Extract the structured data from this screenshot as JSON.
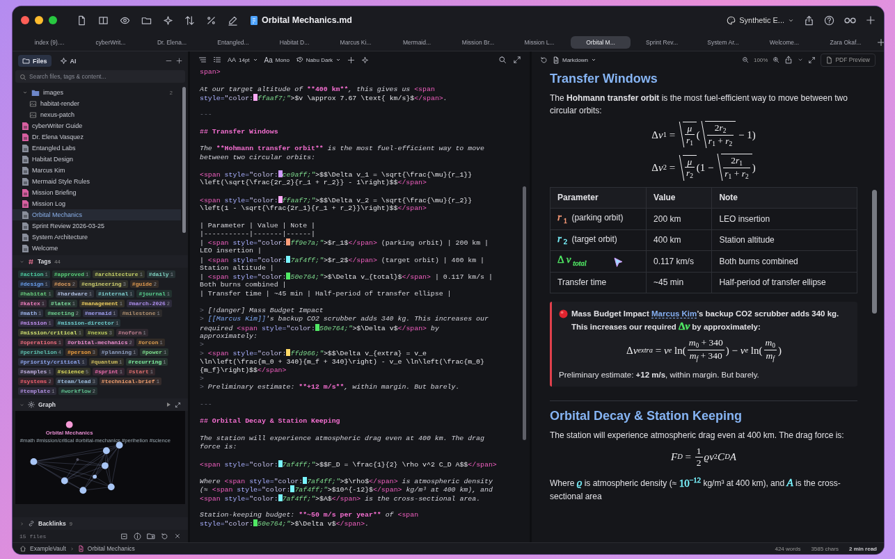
{
  "window": {
    "title": "Orbital Mechanics.md",
    "workspace": "Synthetic E..."
  },
  "tabs": [
    {
      "label": "index (9)....",
      "selected": false
    },
    {
      "label": "cyberWrit...",
      "selected": false
    },
    {
      "label": "Dr. Elena...",
      "selected": false
    },
    {
      "label": "Entangled...",
      "selected": false
    },
    {
      "label": "Habitat D...",
      "selected": false
    },
    {
      "label": "Marcus Ki...",
      "selected": false
    },
    {
      "label": "Mermaid...",
      "selected": false
    },
    {
      "label": "Mission Br...",
      "selected": false
    },
    {
      "label": "Mission L...",
      "selected": false
    },
    {
      "label": "Orbital M...",
      "selected": true
    },
    {
      "label": "Sprint Rev...",
      "selected": false
    },
    {
      "label": "System Ar...",
      "selected": false
    },
    {
      "label": "Welcome...",
      "selected": false
    },
    {
      "label": "Zara Okaf...",
      "selected": false
    }
  ],
  "sidebar": {
    "tabs": [
      {
        "label": "Files",
        "selected": true
      },
      {
        "label": "AI",
        "selected": false
      }
    ],
    "search": {
      "placeholder": "Search files, tags & content..."
    },
    "tree": [
      {
        "kind": "folder",
        "name": "images",
        "count": "2",
        "expanded": true,
        "selected": false,
        "children": [
          {
            "kind": "image",
            "name": "habitat-render",
            "selected": false
          },
          {
            "kind": "image",
            "name": "nexus-patch",
            "selected": false
          }
        ]
      },
      {
        "kind": "file",
        "name": "cyberWriter Guide",
        "color": "#d75fa0",
        "selected": false
      },
      {
        "kind": "file",
        "name": "Dr. Elena Vasquez",
        "color": "#d75fa0",
        "selected": false
      },
      {
        "kind": "file",
        "name": "Entangled Labs",
        "color": "#8a8f9c",
        "selected": false
      },
      {
        "kind": "file",
        "name": "Habitat Design",
        "color": "#8a8f9c",
        "selected": false
      },
      {
        "kind": "file",
        "name": "Marcus Kim",
        "color": "#8a8f9c",
        "selected": false
      },
      {
        "kind": "file",
        "name": "Mermaid Style Rules",
        "color": "#8a8f9c",
        "selected": false
      },
      {
        "kind": "file",
        "name": "Mission Briefing",
        "color": "#d75fa0",
        "selected": false
      },
      {
        "kind": "file",
        "name": "Mission Log",
        "color": "#d75fa0",
        "selected": false
      },
      {
        "kind": "file",
        "name": "Orbital Mechanics",
        "color": "#8a8f9c",
        "selected": true
      },
      {
        "kind": "file",
        "name": "Sprint Review 2026-03-25",
        "color": "#8a8f9c",
        "selected": false
      },
      {
        "kind": "file",
        "name": "System Architecture",
        "color": "#8a8f9c",
        "selected": false
      },
      {
        "kind": "file",
        "name": "Welcome",
        "color": "#8a8f9c",
        "selected": false
      }
    ],
    "tags": {
      "title": "Tags",
      "count": "44",
      "expanded": true,
      "items": [
        {
          "name": "#action",
          "count": "1",
          "color": "#4fd1a5"
        },
        {
          "name": "#approved",
          "count": "1",
          "color": "#5ad17a"
        },
        {
          "name": "#architecture",
          "count": "1",
          "color": "#c8d46a"
        },
        {
          "name": "#daily",
          "count": "1",
          "color": "#7fd1c0"
        },
        {
          "name": "#design",
          "count": "1",
          "color": "#6aa0f0"
        },
        {
          "name": "#docs",
          "count": "2",
          "color": "#e0a060"
        },
        {
          "name": "#engineering",
          "count": "3",
          "color": "#d0d070"
        },
        {
          "name": "#guide",
          "count": "2",
          "color": "#e09a50"
        },
        {
          "name": "#habitat",
          "count": "1",
          "color": "#6ad080"
        },
        {
          "name": "#hardware",
          "count": "1",
          "color": "#b0c0e0"
        },
        {
          "name": "#internal",
          "count": "1",
          "color": "#7fd0d0"
        },
        {
          "name": "#journal",
          "count": "1",
          "color": "#5ad090"
        },
        {
          "name": "#katex",
          "count": "1",
          "color": "#f080c0"
        },
        {
          "name": "#latex",
          "count": "1",
          "color": "#80e0a0"
        },
        {
          "name": "#management",
          "count": "1",
          "color": "#f0d060"
        },
        {
          "name": "#march-2026",
          "count": "2",
          "color": "#b090f0"
        },
        {
          "name": "#math",
          "count": "1",
          "color": "#a0b8f0"
        },
        {
          "name": "#meeting",
          "count": "2",
          "color": "#70d090"
        },
        {
          "name": "#mermaid",
          "count": "1",
          "color": "#a0a0f0"
        },
        {
          "name": "#milestone",
          "count": "1",
          "color": "#b09070"
        },
        {
          "name": "#mission",
          "count": "1",
          "color": "#c090f0"
        },
        {
          "name": "#mission-director",
          "count": "1",
          "color": "#70d0d0"
        },
        {
          "name": "#mission/critical",
          "count": "1",
          "color": "#d0e070"
        },
        {
          "name": "#nexus",
          "count": "3",
          "color": "#c0d060"
        },
        {
          "name": "#noforn",
          "count": "1",
          "color": "#c08090"
        },
        {
          "name": "#operations",
          "count": "1",
          "color": "#f07080"
        },
        {
          "name": "#orbital-mechanics",
          "count": "2",
          "color": "#f090d0"
        },
        {
          "name": "#orcon",
          "count": "1",
          "color": "#e0a050"
        },
        {
          "name": "#perihelion",
          "count": "4",
          "color": "#60c0b0"
        },
        {
          "name": "#person",
          "count": "3",
          "color": "#f0a040"
        },
        {
          "name": "#planning",
          "count": "1",
          "color": "#90a0c0"
        },
        {
          "name": "#power",
          "count": "1",
          "color": "#80e090"
        },
        {
          "name": "#priority/critical",
          "count": "1",
          "color": "#90a8f0"
        },
        {
          "name": "#quantum",
          "count": "1",
          "color": "#d0c060"
        },
        {
          "name": "#recurring",
          "count": "1",
          "color": "#80f0a0"
        },
        {
          "name": "#samples",
          "count": "1",
          "color": "#c0b0e0"
        },
        {
          "name": "#science",
          "count": "5",
          "color": "#e0e060"
        },
        {
          "name": "#sprint",
          "count": "1",
          "color": "#f070b0"
        },
        {
          "name": "#start",
          "count": "1",
          "color": "#e07070"
        },
        {
          "name": "#systems",
          "count": "2",
          "color": "#f06070"
        },
        {
          "name": "#team/lead",
          "count": "3",
          "color": "#a0c0e0"
        },
        {
          "name": "#technical-brief",
          "count": "1",
          "color": "#f0a070"
        },
        {
          "name": "#template",
          "count": "1",
          "color": "#b090e0"
        },
        {
          "name": "#workflow",
          "count": "2",
          "color": "#60c090"
        }
      ]
    },
    "graph": {
      "title": "Graph",
      "expanded": true,
      "focus": "Orbital Mechanics",
      "labels": "#math #mission/critical #orbital-mechanics #perihelion #science"
    },
    "backlinks": {
      "title": "Backlinks",
      "count": "9",
      "expanded": false
    },
    "footer": {
      "files": "15 files"
    }
  },
  "editor": {
    "toolbar": {
      "size_glyph": "AA",
      "font_size": "14pt",
      "font_glyph": "Aa",
      "font": "Mono",
      "theme": "Nabu Dark"
    },
    "blocks": [
      {
        "lines": [
          [
            {
              "kind": "tag",
              "text": "span>"
            }
          ]
        ]
      },
      {
        "lines": [
          [
            {
              "kind": "p",
              "text": "At our target altitude of "
            },
            {
              "kind": "b",
              "text": "**400 km**"
            },
            {
              "kind": "p",
              "text": ", this gives us "
            },
            {
              "kind": "tag",
              "text": "<span"
            }
          ],
          [
            {
              "kind": "at",
              "text": "style="
            },
            {
              "kind": "s",
              "text": "\"color:"
            },
            {
              "kind": "sw",
              "color": "#ffaaf7"
            },
            {
              "kind": "hx",
              "text": "ffaaf7;\""
            },
            {
              "kind": "m",
              "text": ">$v \\approx 7.67 \\text{ km/s}$"
            },
            {
              "kind": "tag",
              "text": "</span>"
            },
            {
              "kind": "p",
              "text": "."
            }
          ]
        ]
      },
      {
        "lines": [
          [
            {
              "kind": "q",
              "text": "---"
            }
          ]
        ]
      },
      {
        "lines": [
          [
            {
              "kind": "h",
              "text": "## Transfer Windows"
            }
          ]
        ]
      },
      {
        "lines": [
          [
            {
              "kind": "p",
              "text": "The "
            },
            {
              "kind": "b",
              "text": "**Hohmann transfer orbit**"
            },
            {
              "kind": "p",
              "text": " is the most fuel-efficient way to move"
            }
          ],
          [
            {
              "kind": "p",
              "text": "between two circular orbits:"
            }
          ]
        ]
      },
      {
        "lines": [
          [
            {
              "kind": "tag",
              "text": "<span"
            },
            {
              "kind": "at",
              "text": " style="
            },
            {
              "kind": "s",
              "text": "\"color:"
            },
            {
              "kind": "sw",
              "color": "#ce9aff"
            },
            {
              "kind": "hx",
              "text": "ce9aff;\""
            },
            {
              "kind": "m",
              "text": ">$$\\Delta v_1 = \\sqrt{\\frac{\\mu}{r_1}}"
            }
          ],
          [
            {
              "kind": "m",
              "text": "\\left(\\sqrt{\\frac{2r_2}{r_1 + r_2}} - 1\\right)$$"
            },
            {
              "kind": "tag",
              "text": "</span>"
            }
          ]
        ]
      },
      {
        "lines": [
          [
            {
              "kind": "tag",
              "text": "<span"
            },
            {
              "kind": "at",
              "text": " style="
            },
            {
              "kind": "s",
              "text": "\"color:"
            },
            {
              "kind": "sw",
              "color": "#ffaaf7"
            },
            {
              "kind": "hx",
              "text": "ffaaf7;\""
            },
            {
              "kind": "m",
              "text": ">$$\\Delta v_2 = \\sqrt{\\frac{\\mu}{r_2}}"
            }
          ],
          [
            {
              "kind": "m",
              "text": "\\left(1 - \\sqrt{\\frac{2r_1}{r_1 + r_2}}\\right)$$"
            },
            {
              "kind": "tag",
              "text": "</span>"
            }
          ]
        ]
      },
      {
        "lines": [
          [
            {
              "kind": "c",
              "text": "| Parameter | Value | Note |"
            }
          ],
          [
            {
              "kind": "c",
              "text": "|-----------|-------|------|"
            }
          ],
          [
            {
              "kind": "c",
              "text": "| "
            },
            {
              "kind": "tag",
              "text": "<span"
            },
            {
              "kind": "at",
              "text": " style="
            },
            {
              "kind": "s",
              "text": "\"color:"
            },
            {
              "kind": "sw",
              "color": "#ff9e7a"
            },
            {
              "kind": "hx",
              "text": "ff9e7a;\""
            },
            {
              "kind": "m",
              "text": ">$r_1$"
            },
            {
              "kind": "tag",
              "text": "</span>"
            },
            {
              "kind": "c",
              "text": " (parking orbit) | 200 km |"
            }
          ],
          [
            {
              "kind": "c",
              "text": "LEO insertion |"
            }
          ],
          [
            {
              "kind": "c",
              "text": "| "
            },
            {
              "kind": "tag",
              "text": "<span"
            },
            {
              "kind": "at",
              "text": " style="
            },
            {
              "kind": "s",
              "text": "\"color:"
            },
            {
              "kind": "sw",
              "color": "#7af4ff"
            },
            {
              "kind": "hx",
              "text": "7af4ff;\""
            },
            {
              "kind": "m",
              "text": ">$r_2$"
            },
            {
              "kind": "tag",
              "text": "</span>"
            },
            {
              "kind": "c",
              "text": " (target orbit) | 400 km |"
            }
          ],
          [
            {
              "kind": "c",
              "text": "Station altitude |"
            }
          ],
          [
            {
              "kind": "c",
              "text": "| "
            },
            {
              "kind": "tag",
              "text": "<span"
            },
            {
              "kind": "at",
              "text": " style="
            },
            {
              "kind": "s",
              "text": "\"color:"
            },
            {
              "kind": "sw",
              "color": "#50e764"
            },
            {
              "kind": "hx",
              "text": "50e764;\""
            },
            {
              "kind": "m",
              "text": ">$\\Delta v_{total}$"
            },
            {
              "kind": "tag",
              "text": "</span>"
            },
            {
              "kind": "c",
              "text": " | 0.117 km/s |"
            }
          ],
          [
            {
              "kind": "c",
              "text": "Both burns combined |"
            }
          ],
          [
            {
              "kind": "c",
              "text": "| Transfer time | ~45 min | Half-period of transfer ellipse |"
            }
          ]
        ]
      },
      {
        "lines": [
          [
            {
              "kind": "q",
              "text": "> "
            },
            {
              "kind": "p",
              "text": "[!danger] Mass Budget Impact"
            }
          ],
          [
            {
              "kind": "q",
              "text": "> "
            },
            {
              "kind": "l",
              "text": "[[Marcus Kim]]"
            },
            {
              "kind": "p",
              "text": "'s backup CO2 scrubber adds 340 kg. This increases our"
            }
          ],
          [
            {
              "kind": "p",
              "text": "required "
            },
            {
              "kind": "tag",
              "text": "<span"
            },
            {
              "kind": "at",
              "text": " style="
            },
            {
              "kind": "s",
              "text": "\"color:"
            },
            {
              "kind": "sw",
              "color": "#50e764"
            },
            {
              "kind": "hx",
              "text": "50e764;\""
            },
            {
              "kind": "m",
              "text": ">$\\Delta v$"
            },
            {
              "kind": "tag",
              "text": "</span>"
            },
            {
              "kind": "p",
              "text": " by"
            }
          ],
          [
            {
              "kind": "p",
              "text": "approximately:"
            }
          ],
          [
            {
              "kind": "q",
              "text": ">"
            }
          ],
          [
            {
              "kind": "q",
              "text": "> "
            },
            {
              "kind": "tag",
              "text": "<span"
            },
            {
              "kind": "at",
              "text": " style="
            },
            {
              "kind": "s",
              "text": "\"color:"
            },
            {
              "kind": "sw",
              "color": "#ffd966"
            },
            {
              "kind": "hx",
              "text": "ffd966;\""
            },
            {
              "kind": "m",
              "text": ">$$\\Delta v_{extra} = v_e"
            }
          ],
          [
            {
              "kind": "m",
              "text": "\\ln\\left(\\frac{m_0 + 340}{m_f + 340}\\right) - v_e \\ln\\left(\\frac{m_0}"
            }
          ],
          [
            {
              "kind": "m",
              "text": "{m_f}\\right)$$"
            },
            {
              "kind": "tag",
              "text": "</span>"
            }
          ],
          [
            {
              "kind": "q",
              "text": ">"
            }
          ],
          [
            {
              "kind": "q",
              "text": "> "
            },
            {
              "kind": "p",
              "text": "Preliminary estimate: "
            },
            {
              "kind": "b",
              "text": "**+12 m/s**"
            },
            {
              "kind": "p",
              "text": ", within margin. But barely."
            }
          ]
        ]
      },
      {
        "lines": [
          [
            {
              "kind": "q",
              "text": "---"
            }
          ]
        ]
      },
      {
        "lines": [
          [
            {
              "kind": "h",
              "text": "## Orbital Decay & Station Keeping"
            }
          ]
        ]
      },
      {
        "lines": [
          [
            {
              "kind": "p",
              "text": "The station will experience atmospheric drag even at 400 km. The drag"
            }
          ],
          [
            {
              "kind": "p",
              "text": "force is:"
            }
          ]
        ]
      },
      {
        "lines": [
          [
            {
              "kind": "tag",
              "text": "<span"
            },
            {
              "kind": "at",
              "text": " style="
            },
            {
              "kind": "s",
              "text": "\"color:"
            },
            {
              "kind": "sw",
              "color": "#7af4ff"
            },
            {
              "kind": "hx",
              "text": "7af4ff;\""
            },
            {
              "kind": "m",
              "text": ">$$F_D = \\frac{1}{2} \\rho v^2 C_D A$$"
            },
            {
              "kind": "tag",
              "text": "</span>"
            }
          ]
        ]
      },
      {
        "lines": [
          [
            {
              "kind": "p",
              "text": "Where "
            },
            {
              "kind": "tag",
              "text": "<span"
            },
            {
              "kind": "at",
              "text": " style="
            },
            {
              "kind": "s",
              "text": "\"color:"
            },
            {
              "kind": "sw",
              "color": "#7af4ff"
            },
            {
              "kind": "hx",
              "text": "7af4ff;\""
            },
            {
              "kind": "m",
              "text": ">$\\rho$"
            },
            {
              "kind": "tag",
              "text": "</span>"
            },
            {
              "kind": "p",
              "text": " is atmospheric density"
            }
          ],
          [
            {
              "kind": "p",
              "text": "(≈ "
            },
            {
              "kind": "tag",
              "text": "<span"
            },
            {
              "kind": "at",
              "text": " style="
            },
            {
              "kind": "s",
              "text": "\"color:"
            },
            {
              "kind": "sw",
              "color": "#7af4ff"
            },
            {
              "kind": "hx",
              "text": "7af4ff;\""
            },
            {
              "kind": "m",
              "text": ">$10^{-12}$"
            },
            {
              "kind": "tag",
              "text": "</span>"
            },
            {
              "kind": "p",
              "text": " kg/m³ at 400 km), and"
            }
          ],
          [
            {
              "kind": "tag",
              "text": "<span"
            },
            {
              "kind": "at",
              "text": " style="
            },
            {
              "kind": "s",
              "text": "\"color:"
            },
            {
              "kind": "sw",
              "color": "#7af4ff"
            },
            {
              "kind": "hx",
              "text": "7af4ff;\""
            },
            {
              "kind": "m",
              "text": ">$A$"
            },
            {
              "kind": "tag",
              "text": "</span>"
            },
            {
              "kind": "p",
              "text": " is the cross-sectional area."
            }
          ]
        ]
      },
      {
        "lines": [
          [
            {
              "kind": "p",
              "text": "Station-keeping budget: "
            },
            {
              "kind": "b",
              "text": "**~50 m/s per year**"
            },
            {
              "kind": "p",
              "text": " of "
            },
            {
              "kind": "tag",
              "text": "<span"
            }
          ],
          [
            {
              "kind": "at",
              "text": "style="
            },
            {
              "kind": "s",
              "text": "\"color:"
            },
            {
              "kind": "sw",
              "color": "#50e764"
            },
            {
              "kind": "hx",
              "text": "50e764;\""
            },
            {
              "kind": "m",
              "text": ">$\\Delta v$"
            },
            {
              "kind": "tag",
              "text": "</span>"
            },
            {
              "kind": "p",
              "text": "."
            }
          ]
        ]
      }
    ]
  },
  "preview": {
    "toolbar": {
      "mode": "Markdown",
      "zoom": "100%",
      "pdf": "PDF Preview"
    },
    "content": [
      {
        "kind": "h2",
        "text": "Transfer Windows"
      },
      {
        "kind": "p",
        "segments": [
          {
            "kind": "text",
            "text": "The **Hohmann transfer orbit** is the most fuel-efficient way to move between two circular orbits:"
          }
        ]
      },
      {
        "kind": "formula",
        "nodes": [
          {
            "kind": "n",
            "text": "Δ"
          },
          {
            "kind": "i",
            "text": "v"
          },
          {
            "kind": "sub",
            "body": [
              {
                "kind": "n",
                "text": "1"
              }
            ]
          },
          {
            "kind": "n",
            "text": " = "
          },
          {
            "kind": "sqrt",
            "body": [
              {
                "kind": "frac",
                "num": [
                  {
                    "kind": "i",
                    "text": "μ"
                  }
                ],
                "den": [
                  {
                    "kind": "i",
                    "text": "r"
                  },
                  {
                    "kind": "sub",
                    "body": [
                      {
                        "kind": "n",
                        "text": "1"
                      }
                    ]
                  }
                ]
              }
            ]
          },
          {
            "kind": "n",
            "text": "("
          },
          {
            "kind": "sqrt",
            "body": [
              {
                "kind": "frac",
                "num": [
                  {
                    "kind": "n",
                    "text": "2"
                  },
                  {
                    "kind": "i",
                    "text": "r"
                  },
                  {
                    "kind": "sub",
                    "body": [
                      {
                        "kind": "n",
                        "text": "2"
                      }
                    ]
                  }
                ],
                "den": [
                  {
                    "kind": "i",
                    "text": "r"
                  },
                  {
                    "kind": "sub",
                    "body": [
                      {
                        "kind": "n",
                        "text": "1"
                      }
                    ]
                  },
                  {
                    "kind": "n",
                    "text": " + "
                  },
                  {
                    "kind": "i",
                    "text": "r"
                  },
                  {
                    "kind": "sub",
                    "body": [
                      {
                        "kind": "n",
                        "text": "2"
                      }
                    ]
                  }
                ]
              }
            ]
          },
          {
            "kind": "n",
            "text": " − 1)"
          }
        ]
      },
      {
        "kind": "formula",
        "nodes": [
          {
            "kind": "n",
            "text": "Δ"
          },
          {
            "kind": "i",
            "text": "v"
          },
          {
            "kind": "sub",
            "body": [
              {
                "kind": "n",
                "text": "2"
              }
            ]
          },
          {
            "kind": "n",
            "text": " = "
          },
          {
            "kind": "sqrt",
            "body": [
              {
                "kind": "frac",
                "num": [
                  {
                    "kind": "i",
                    "text": "μ"
                  }
                ],
                "den": [
                  {
                    "kind": "i",
                    "text": "r"
                  },
                  {
                    "kind": "sub",
                    "body": [
                      {
                        "kind": "n",
                        "text": "2"
                      }
                    ]
                  }
                ]
              }
            ]
          },
          {
            "kind": "n",
            "text": "(1 − "
          },
          {
            "kind": "sqrt",
            "body": [
              {
                "kind": "frac",
                "num": [
                  {
                    "kind": "n",
                    "text": "2"
                  },
                  {
                    "kind": "i",
                    "text": "r"
                  },
                  {
                    "kind": "sub",
                    "body": [
                      {
                        "kind": "n",
                        "text": "1"
                      }
                    ]
                  }
                ],
                "den": [
                  {
                    "kind": "i",
                    "text": "r"
                  },
                  {
                    "kind": "sub",
                    "body": [
                      {
                        "kind": "n",
                        "text": "1"
                      }
                    ]
                  },
                  {
                    "kind": "n",
                    "text": " + "
                  },
                  {
                    "kind": "i",
                    "text": "r"
                  },
                  {
                    "kind": "sub",
                    "body": [
                      {
                        "kind": "n",
                        "text": "2"
                      }
                    ]
                  }
                ]
              }
            ]
          },
          {
            "kind": "n",
            "text": ")"
          }
        ]
      },
      {
        "kind": "table",
        "columns": [
          "Parameter",
          "Value",
          "Note"
        ],
        "rows": [
          {
            "param": {
              "math": [
                {
                  "kind": "i",
                  "text": "r"
                },
                {
                  "kind": "sub",
                  "body": [
                    {
                      "kind": "n",
                      "text": "1"
                    }
                  ]
                }
              ],
              "color": "#ff9e7a",
              "text": "(parking orbit)"
            },
            "value": "200 km",
            "note": "LEO insertion"
          },
          {
            "param": {
              "math": [
                {
                  "kind": "i",
                  "text": "r"
                },
                {
                  "kind": "sub",
                  "body": [
                    {
                      "kind": "n",
                      "text": "2"
                    }
                  ]
                }
              ],
              "color": "#7af4ff",
              "text": "(target orbit)"
            },
            "value": "400 km",
            "note": "Station altitude"
          },
          {
            "param": {
              "math": [
                {
                  "kind": "n",
                  "text": "Δ"
                },
                {
                  "kind": "i",
                  "text": "v"
                },
                {
                  "kind": "sub",
                  "body": [
                    {
                      "kind": "i",
                      "text": "total"
                    }
                  ]
                }
              ],
              "color": "#50e764"
            },
            "value": "0.117 km/s",
            "note": "Both burns combined"
          },
          {
            "param": {
              "text": "Transfer time"
            },
            "value": "~45 min",
            "note": "Half-period of transfer ellipse"
          }
        ]
      },
      {
        "kind": "callout_danger",
        "title": "Mass Budget Impact",
        "body": [
          {
            "kind": "link",
            "text": "Marcus Kim"
          },
          {
            "kind": "text",
            "text": "’s backup CO2 scrubber adds 340 kg. This increases our required "
          },
          {
            "kind": "math",
            "color": "#50e764",
            "nodes": [
              {
                "kind": "n",
                "text": "Δ"
              },
              {
                "kind": "i",
                "text": "v"
              }
            ]
          },
          {
            "kind": "text",
            "text": " by approximately:"
          }
        ],
        "formula": [
          {
            "kind": "n",
            "text": "Δ"
          },
          {
            "kind": "i",
            "text": "v"
          },
          {
            "kind": "sub",
            "body": [
              {
                "kind": "i",
                "text": "extra"
              }
            ]
          },
          {
            "kind": "n",
            "text": " = "
          },
          {
            "kind": "i",
            "text": "v"
          },
          {
            "kind": "sub",
            "body": [
              {
                "kind": "i",
                "text": "e"
              }
            ]
          },
          {
            "kind": "n",
            "text": " ln("
          },
          {
            "kind": "frac",
            "num": [
              {
                "kind": "i",
                "text": "m"
              },
              {
                "kind": "sub",
                "body": [
                  {
                    "kind": "n",
                    "text": "0"
                  }
                ]
              },
              {
                "kind": "n",
                "text": " + 340"
              }
            ],
            "den": [
              {
                "kind": "i",
                "text": "m"
              },
              {
                "kind": "sub",
                "body": [
                  {
                    "kind": "i",
                    "text": "f"
                  }
                ]
              },
              {
                "kind": "n",
                "text": " + 340"
              }
            ]
          },
          {
            "kind": "n",
            "text": ") − "
          },
          {
            "kind": "i",
            "text": "v"
          },
          {
            "kind": "sub",
            "body": [
              {
                "kind": "i",
                "text": "e"
              }
            ]
          },
          {
            "kind": "n",
            "text": " ln("
          },
          {
            "kind": "frac",
            "num": [
              {
                "kind": "i",
                "text": "m"
              },
              {
                "kind": "sub",
                "body": [
                  {
                    "kind": "n",
                    "text": "0"
                  }
                ]
              }
            ],
            "den": [
              {
                "kind": "i",
                "text": "m"
              },
              {
                "kind": "sub",
                "body": [
                  {
                    "kind": "i",
                    "text": "f"
                  }
                ]
              }
            ]
          },
          {
            "kind": "n",
            "text": ")"
          }
        ],
        "note": "Preliminary estimate: **+12 m/s**, within margin. But barely."
      },
      {
        "kind": "hr"
      },
      {
        "kind": "h2",
        "text": "Orbital Decay & Station Keeping"
      },
      {
        "kind": "p",
        "segments": [
          {
            "kind": "text",
            "text": "The station will experience atmospheric drag even at 400 km. The drag force is:"
          }
        ]
      },
      {
        "kind": "formula",
        "nodes": [
          {
            "kind": "i",
            "text": "F"
          },
          {
            "kind": "sub",
            "body": [
              {
                "kind": "i",
                "text": "D"
              }
            ]
          },
          {
            "kind": "n",
            "text": " = "
          },
          {
            "kind": "frac",
            "num": [
              {
                "kind": "n",
                "text": "1"
              }
            ],
            "den": [
              {
                "kind": "n",
                "text": "2"
              }
            ]
          },
          {
            "kind": "i",
            "text": "ϱv"
          },
          {
            "kind": "sup",
            "body": [
              {
                "kind": "n",
                "text": "2"
              }
            ]
          },
          {
            "kind": "i",
            "text": "C"
          },
          {
            "kind": "sub",
            "body": [
              {
                "kind": "i",
                "text": "D"
              }
            ]
          },
          {
            "kind": "i",
            "text": "A"
          }
        ]
      },
      {
        "kind": "p",
        "segments": [
          {
            "kind": "text",
            "text": "Where "
          },
          {
            "kind": "math",
            "color": "#7af4ff",
            "nodes": [
              {
                "kind": "i",
                "text": "ϱ"
              }
            ]
          },
          {
            "kind": "text",
            "text": " is atmospheric density (≈ "
          },
          {
            "kind": "math",
            "color": "#7af4ff",
            "nodes": [
              {
                "kind": "n",
                "text": "10"
              },
              {
                "kind": "sup",
                "body": [
                  {
                    "kind": "n",
                    "text": "−12"
                  }
                ]
              }
            ]
          },
          {
            "kind": "text",
            "text": " kg/m³ at 400 km), and "
          },
          {
            "kind": "math",
            "color": "#7af4ff",
            "nodes": [
              {
                "kind": "i",
                "text": "A"
              }
            ]
          },
          {
            "kind": "text",
            "text": " is the cross-sectional area"
          }
        ]
      }
    ]
  },
  "status_bar": {
    "vault": "ExampleVault",
    "note": "Orbital Mechanics",
    "words": "424 words",
    "chars": "3585 chars",
    "read": "2 min read"
  }
}
